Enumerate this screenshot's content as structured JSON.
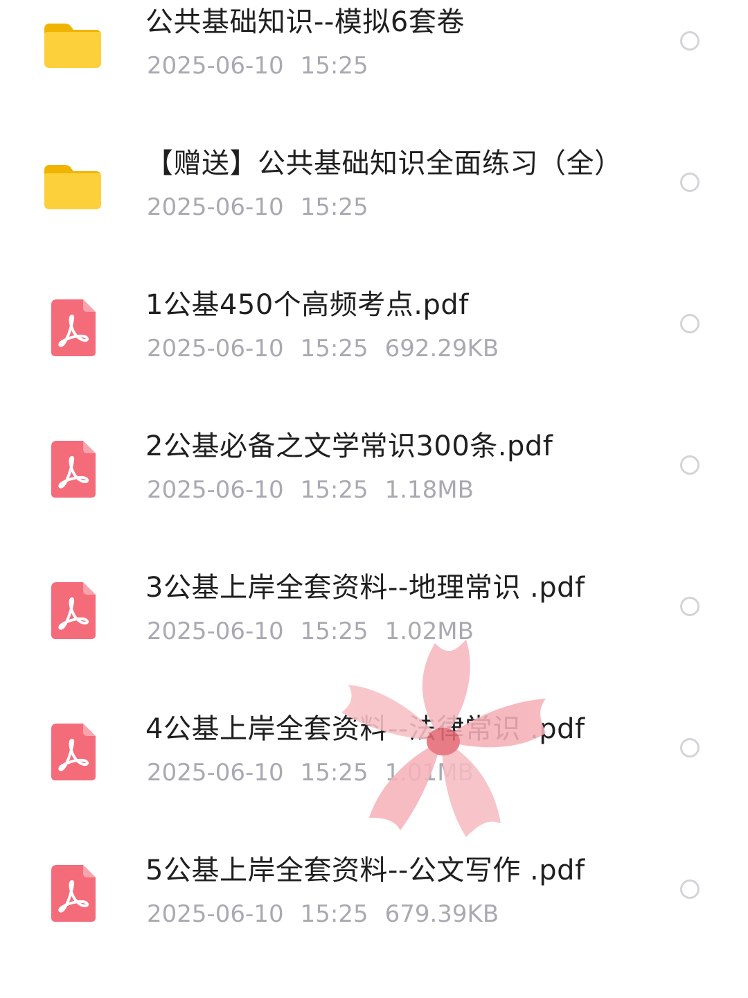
{
  "files": [
    {
      "type": "folder",
      "icon": "folder-icon",
      "name": "公共基础知识--模拟6套卷",
      "date": "2025-06-10",
      "time": "15:25",
      "size": ""
    },
    {
      "type": "folder",
      "icon": "folder-icon",
      "name": "【赠送】公共基础知识全面练习（全）",
      "date": "2025-06-10",
      "time": "15:25",
      "size": ""
    },
    {
      "type": "pdf",
      "icon": "pdf-icon",
      "name": "1公基450个高频考点.pdf",
      "date": "2025-06-10",
      "time": "15:25",
      "size": "692.29KB"
    },
    {
      "type": "pdf",
      "icon": "pdf-icon",
      "name": "2公基必备之文学常识300条.pdf",
      "date": "2025-06-10",
      "time": "15:25",
      "size": "1.18MB"
    },
    {
      "type": "pdf",
      "icon": "pdf-icon",
      "name": "3公基上岸全套资料--地理常识 .pdf",
      "date": "2025-06-10",
      "time": "15:25",
      "size": "1.02MB"
    },
    {
      "type": "pdf",
      "icon": "pdf-icon",
      "name": "4公基上岸全套资料--法律常识 .pdf",
      "date": "2025-06-10",
      "time": "15:25",
      "size": "1.01MB"
    },
    {
      "type": "pdf",
      "icon": "pdf-icon",
      "name": "5公基上岸全套资料--公文写作 .pdf",
      "date": "2025-06-10",
      "time": "15:25",
      "size": "679.39KB"
    }
  ],
  "colors": {
    "folder": "#fcc419",
    "pdf": "#f25f6e",
    "meta_text": "#a9a9b2",
    "name_text": "#1f1f1f",
    "radio_border": "#d4d4d8",
    "flower": "#f6b7bd"
  },
  "decoration": {
    "icon": "flower-sticker-icon"
  }
}
